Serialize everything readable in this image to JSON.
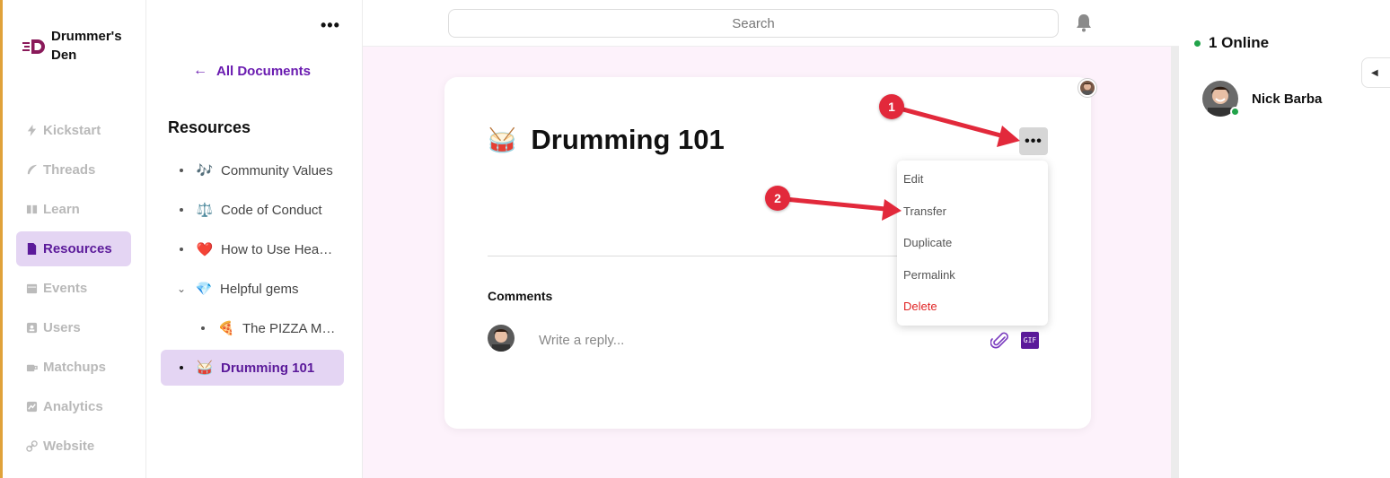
{
  "brand": {
    "name": "Drummer's Den",
    "logo_color": "#8a1a5a"
  },
  "nav": {
    "items": [
      {
        "label": "Kickstart",
        "icon": "bolt-icon"
      },
      {
        "label": "Threads",
        "icon": "feather-icon"
      },
      {
        "label": "Learn",
        "icon": "book-icon"
      },
      {
        "label": "Resources",
        "icon": "document-icon",
        "active": true
      },
      {
        "label": "Events",
        "icon": "calendar-icon"
      },
      {
        "label": "Users",
        "icon": "user-card-icon"
      },
      {
        "label": "Matchups",
        "icon": "coffee-icon"
      },
      {
        "label": "Analytics",
        "icon": "chart-icon"
      },
      {
        "label": "Website",
        "icon": "link-icon"
      }
    ]
  },
  "docs": {
    "more_label": "•••",
    "back_label": "All Documents",
    "section_title": "Resources",
    "items": [
      {
        "emoji": "🎶",
        "label": "Community Values"
      },
      {
        "emoji": "⚖️",
        "label": "Code of Conduct"
      },
      {
        "emoji": "❤️",
        "label": "How to Use Hea…"
      },
      {
        "emoji": "💎",
        "label": "Helpful gems",
        "expanded": true
      },
      {
        "emoji": "🍕",
        "label": "The PIZZA M…",
        "child": true
      },
      {
        "emoji": "🥁",
        "label": "Drumming 101",
        "active": true
      }
    ]
  },
  "topbar": {
    "search_placeholder": "Search"
  },
  "document": {
    "emoji": "🥁",
    "title": "Drumming 101",
    "kebab_label": "•••",
    "comments_title": "Comments",
    "reply_placeholder": "Write a reply...",
    "gif_label": "GIF"
  },
  "menu": {
    "items": [
      {
        "label": "Edit"
      },
      {
        "label": "Transfer"
      },
      {
        "label": "Duplicate"
      },
      {
        "label": "Permalink"
      },
      {
        "label": "Delete",
        "danger": true
      }
    ]
  },
  "annotations": {
    "badge_1": "1",
    "badge_2": "2",
    "color": "#e2293b"
  },
  "online": {
    "title": "1 Online",
    "users": [
      {
        "name": "Nick Barba",
        "status": "online"
      }
    ]
  },
  "colors": {
    "accent": "#5b1a9a",
    "active_bg": "#e4d5f3",
    "danger": "#e02424",
    "online": "#22a34a"
  }
}
